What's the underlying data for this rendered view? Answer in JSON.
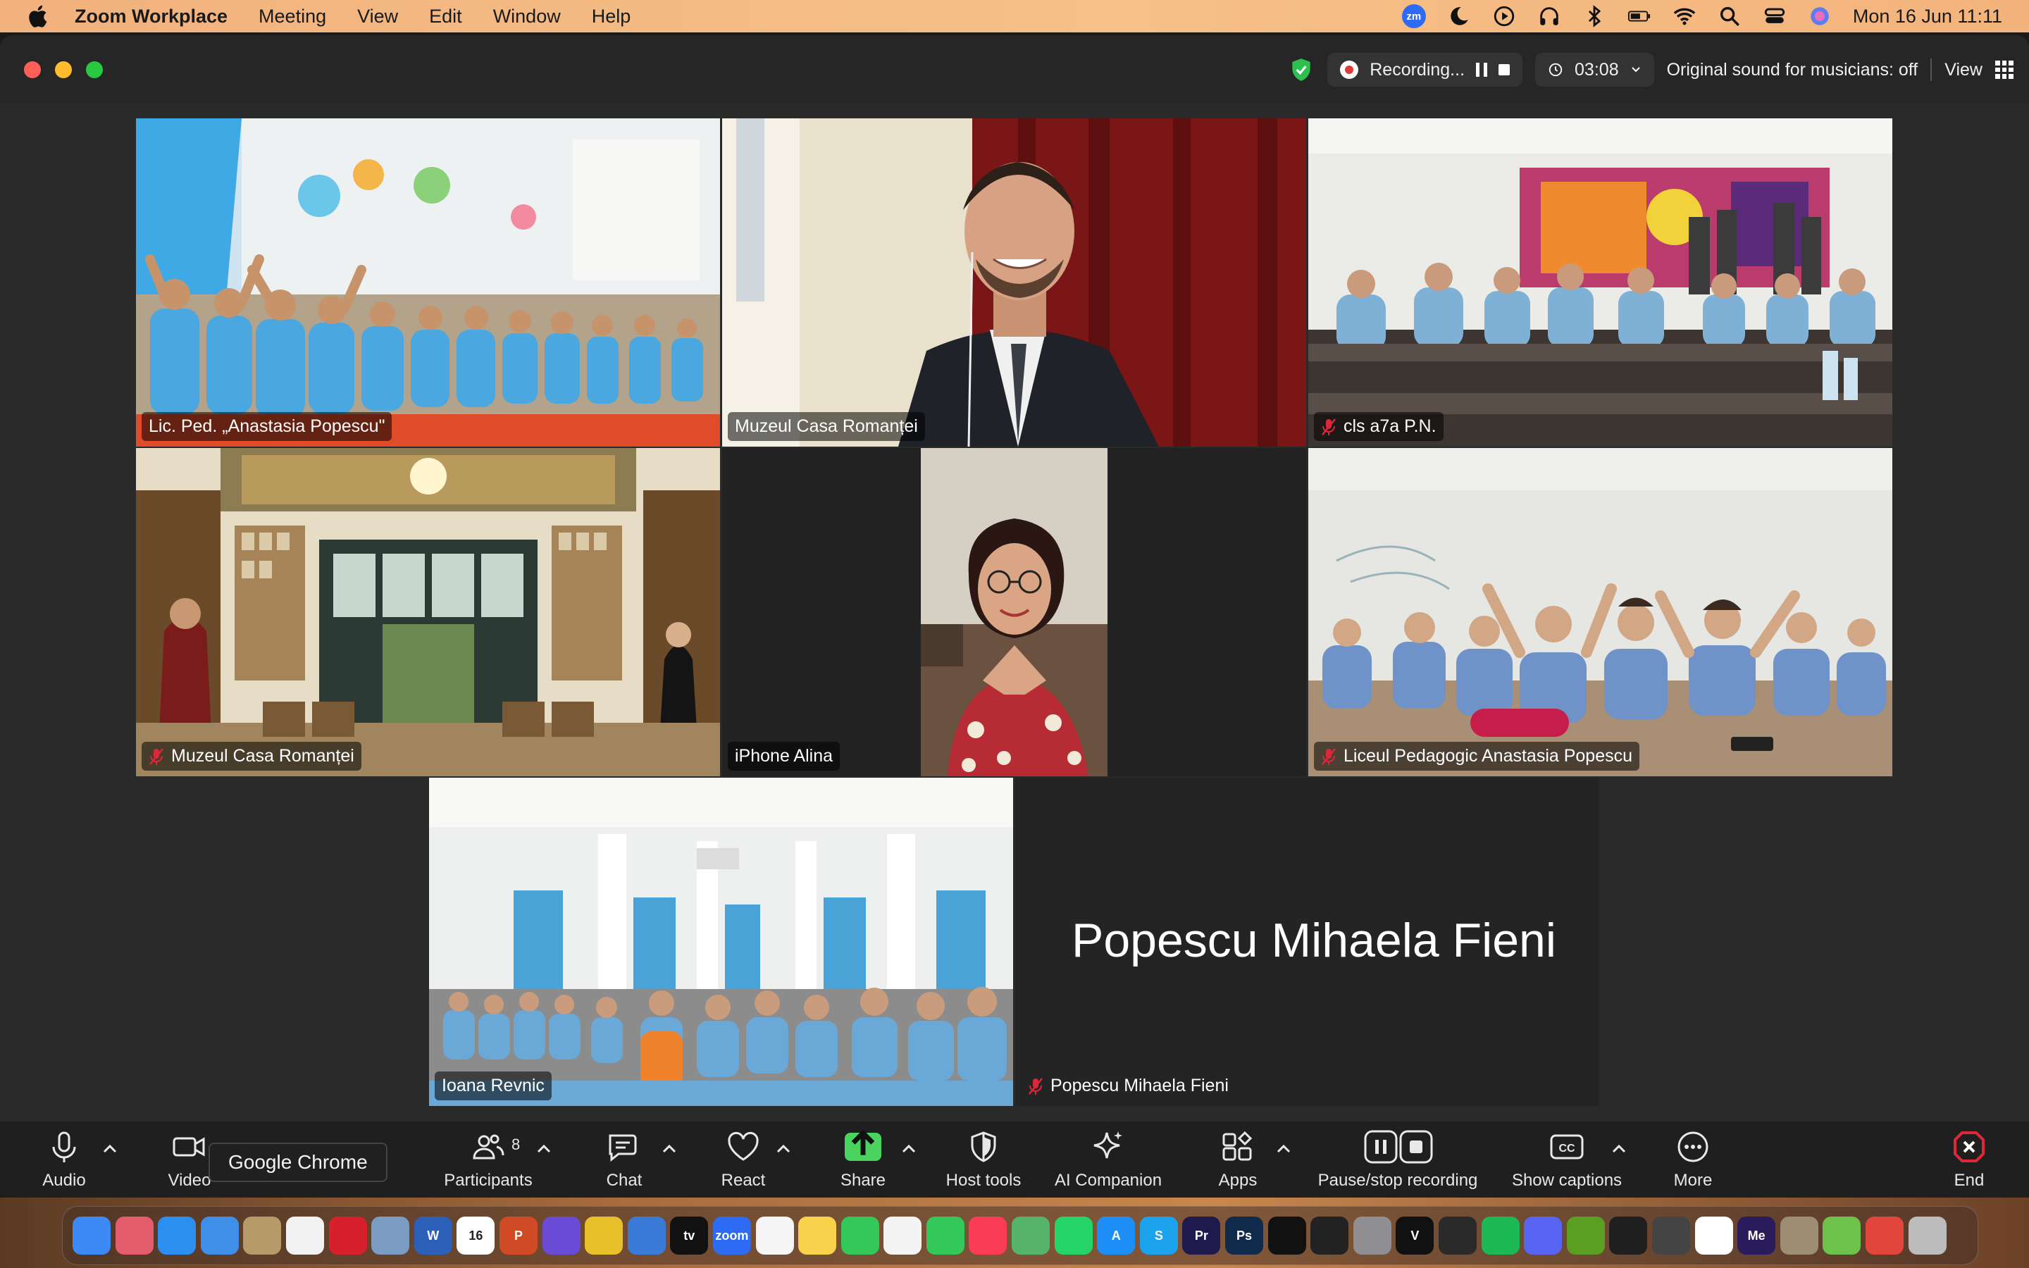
{
  "menubar": {
    "app_name": "Zoom Workplace",
    "items": [
      "Meeting",
      "View",
      "Edit",
      "Window",
      "Help"
    ],
    "zoom_badge": "zm",
    "clock": "Mon 16 Jun  11:11",
    "status_icons": [
      "zoom-icon",
      "moon-icon",
      "play-icon",
      "headphones-icon",
      "bluetooth-icon",
      "battery-icon",
      "wifi-icon",
      "search-icon",
      "control-center-icon",
      "siri-icon"
    ]
  },
  "meeting_status": {
    "recording_label": "Recording...",
    "timer": "03:08",
    "original_sound": "Original sound for musicians: off",
    "view_label": "View"
  },
  "tiles": [
    {
      "name": "Lic. Ped. „Anastasia Popescu\"",
      "muted": false,
      "scene": "classroom with students raising hands"
    },
    {
      "name": "Muzeul Casa Romanței",
      "muted": false,
      "scene": "man in suit smiling"
    },
    {
      "name": "cls a7a P.N.",
      "muted": true,
      "scene": "classroom desks"
    },
    {
      "name": "Muzeul Casa Romanței",
      "muted": true,
      "scene": "museum hall"
    },
    {
      "name": "iPhone Alina",
      "muted": false,
      "active": true,
      "scene": "woman with glasses"
    },
    {
      "name": "Liceul Pedagogic Anastasia Popescu",
      "muted": true,
      "scene": "classroom students"
    },
    {
      "name": "Ioana Revnic",
      "muted": false,
      "scene": "auditorium students"
    },
    {
      "name": "Popescu Mihaela Fieni",
      "muted": true,
      "big_name": "Popescu Mihaela Fieni"
    }
  ],
  "toolbar": {
    "audio": "Audio",
    "video": "Video",
    "participants": "Participants",
    "participants_count": "8",
    "chat": "Chat",
    "react": "React",
    "share": "Share",
    "host_tools": "Host tools",
    "ai_companion": "AI Companion",
    "apps": "Apps",
    "pause_stop": "Pause/stop recording",
    "captions": "Show captions",
    "more": "More",
    "end": "End",
    "tooltip": "Google Chrome"
  },
  "dock": {
    "icons": [
      {
        "name": "finder-icon",
        "color": "#3d8af7",
        "label": ""
      },
      {
        "name": "launchpad-icon",
        "color": "#e45d6c",
        "label": ""
      },
      {
        "name": "safari-icon",
        "color": "#2c8ff0",
        "label": ""
      },
      {
        "name": "mail-icon",
        "color": "#3f8fe8",
        "label": ""
      },
      {
        "name": "notes-folder-icon",
        "color": "#b79a6a",
        "label": ""
      },
      {
        "name": "chrome-icon",
        "color": "#f2f2f2",
        "label": ""
      },
      {
        "name": "opera-icon",
        "color": "#d6202c",
        "label": ""
      },
      {
        "name": "preview-icon",
        "color": "#7a9cc2",
        "label": ""
      },
      {
        "name": "word-icon",
        "color": "#2b5fb8",
        "label": "W"
      },
      {
        "name": "calendar-icon",
        "color": "#ffffff",
        "label": "16"
      },
      {
        "name": "powerpoint-icon",
        "color": "#d04a25",
        "label": "P"
      },
      {
        "name": "siri-dock-icon",
        "color": "#6a4bd6",
        "label": ""
      },
      {
        "name": "yellow-app-icon",
        "color": "#e8c02a",
        "label": ""
      },
      {
        "name": "freeform-icon",
        "color": "#3b7bd8",
        "label": ""
      },
      {
        "name": "apple-tv-icon",
        "color": "#111111",
        "label": "tv"
      },
      {
        "name": "zoom-dock-icon",
        "color": "#2d6bf4",
        "label": "zoom"
      },
      {
        "name": "reminders-icon",
        "color": "#f5f5f5",
        "label": ""
      },
      {
        "name": "notes-icon",
        "color": "#f7d24a",
        "label": ""
      },
      {
        "name": "facetime-icon",
        "color": "#34c759",
        "label": ""
      },
      {
        "name": "photos-icon",
        "color": "#f4f4f4",
        "label": ""
      },
      {
        "name": "messages-icon",
        "color": "#34c759",
        "label": ""
      },
      {
        "name": "music-icon",
        "color": "#fa3c56",
        "label": ""
      },
      {
        "name": "maps-icon",
        "color": "#55b36a",
        "label": ""
      },
      {
        "name": "whatsapp-icon",
        "color": "#25d366",
        "label": ""
      },
      {
        "name": "app-store-icon",
        "color": "#1c8ef5",
        "label": "A"
      },
      {
        "name": "skype-icon",
        "color": "#1ca3ee",
        "label": "S"
      },
      {
        "name": "premiere-icon",
        "color": "#1e1a4d",
        "label": "Pr"
      },
      {
        "name": "photoshop-icon",
        "color": "#0f2a4a",
        "label": "Ps"
      },
      {
        "name": "tiktok-icon",
        "color": "#111111",
        "label": ""
      },
      {
        "name": "capcut-icon",
        "color": "#222222",
        "label": ""
      },
      {
        "name": "system-settings-icon",
        "color": "#8e8e93",
        "label": ""
      },
      {
        "name": "vectorworks-icon",
        "color": "#111111",
        "label": "V"
      },
      {
        "name": "audio-app-icon",
        "color": "#2a2a2a",
        "label": ""
      },
      {
        "name": "spotify-icon",
        "color": "#1db954",
        "label": ""
      },
      {
        "name": "discord-icon",
        "color": "#5865f2",
        "label": ""
      },
      {
        "name": "nvidia-icon",
        "color": "#5a9e22",
        "label": ""
      },
      {
        "name": "quicktime-icon",
        "color": "#1f1f1f",
        "label": ""
      },
      {
        "name": "phone-app-icon",
        "color": "#444444",
        "label": ""
      },
      {
        "name": "microsoft-icon",
        "color": "#ffffff",
        "label": ""
      },
      {
        "name": "media-encoder-icon",
        "color": "#2a1c5c",
        "label": "Me"
      },
      {
        "name": "photo-folder-icon",
        "color": "#9c8d74",
        "label": ""
      },
      {
        "name": "cloud-app-icon",
        "color": "#6cc24a",
        "label": ""
      },
      {
        "name": "creative-cloud-icon",
        "color": "#e2453c",
        "label": ""
      },
      {
        "name": "trash-icon",
        "color": "#bcbcbc",
        "label": ""
      }
    ]
  },
  "colors": {
    "active_speaker": "#5fd35a",
    "share_green": "#4bd35f",
    "end_red": "#e0263b",
    "muted_red": "#e0263b"
  }
}
